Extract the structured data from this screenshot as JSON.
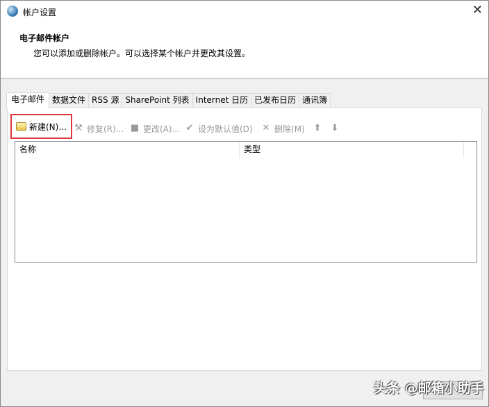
{
  "window": {
    "title": "帐户设置",
    "close_icon": "close-icon"
  },
  "header": {
    "title": "电子邮件帐户",
    "description": "您可以添加或删除帐户。可以选择某个帐户并更改其设置。"
  },
  "tabs": [
    {
      "label": "电子邮件",
      "active": true
    },
    {
      "label": "数据文件"
    },
    {
      "label": "RSS 源"
    },
    {
      "label": "SharePoint 列表"
    },
    {
      "label": "Internet 日历"
    },
    {
      "label": "已发布日历"
    },
    {
      "label": "通讯簿"
    }
  ],
  "toolbar": {
    "new": "新建(N)...",
    "repair": "修复(R)...",
    "change": "更改(A)...",
    "set_default": "设为默认值(D)",
    "remove": "删除(M)"
  },
  "list": {
    "columns": [
      "名称",
      "类型"
    ],
    "rows": []
  },
  "watermark": "头条 @邮箱小助手"
}
